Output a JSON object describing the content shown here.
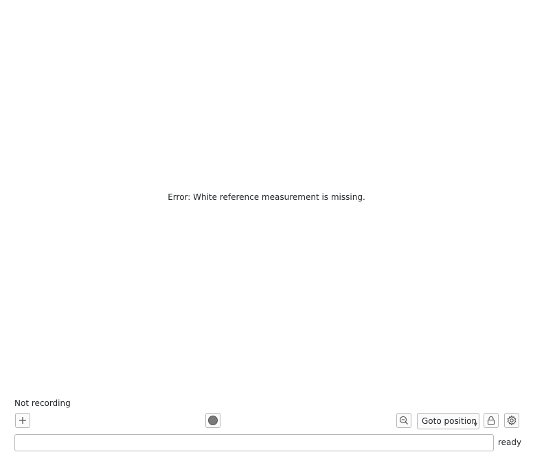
{
  "main": {
    "error_message": "Error: White reference measurement is missing."
  },
  "recording": {
    "status_label": "Not recording"
  },
  "toolbar": {
    "add_icon": "plus-icon",
    "record_icon": "record-indicator-icon",
    "zoom_out_icon": "zoom-out-icon",
    "goto_label": "Goto position",
    "lock_icon": "lock-icon",
    "settings_icon": "gear-icon"
  },
  "status": {
    "progress_value": 0,
    "state_label": "ready"
  }
}
